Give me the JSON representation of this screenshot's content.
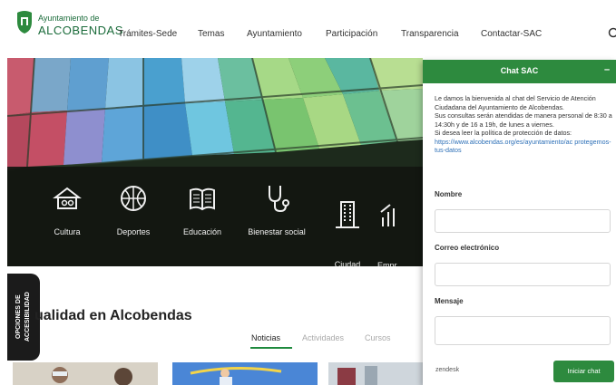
{
  "header": {
    "logo": {
      "line1": "Ayuntamiento de",
      "line2": "ALCOBENDAS"
    },
    "nav": [
      {
        "label": "Trámites-Sede"
      },
      {
        "label": "Temas"
      },
      {
        "label": "Ayuntamiento"
      },
      {
        "label": "Participación"
      },
      {
        "label": "Transparencia"
      },
      {
        "label": "Contactar-SAC"
      }
    ],
    "search_icon": "search-icon"
  },
  "hero": {
    "categories": [
      {
        "label": "Cultura",
        "icon": "culture-icon"
      },
      {
        "label": "Deportes",
        "icon": "basketball-icon"
      },
      {
        "label": "Educación",
        "icon": "book-icon"
      },
      {
        "label": "Bienestar social",
        "icon": "stethoscope-icon"
      },
      {
        "label": "Ciudad\nSostenible",
        "icon": "building-icon"
      },
      {
        "label": "Empr\nCome\nEmpl",
        "icon": "chart-icon"
      }
    ]
  },
  "accessibility": {
    "label": "OPCIONES DE ACCESIBILIDAD"
  },
  "news": {
    "title": "ualidad en Alcobendas",
    "tabs": [
      {
        "label": "Noticias",
        "active": true
      },
      {
        "label": "Actividades",
        "active": false
      },
      {
        "label": "Cursos",
        "active": false
      }
    ]
  },
  "chat": {
    "title": "Chat SAC",
    "minimize": "–",
    "intro": "Le damos la bienvenida al chat del Servicio de Atención Ciudadana del Ayuntamiento de Alcobendas.",
    "hours": "Sus consultas serán atendidas de manera personal de 8:30 a 14:30h y de 16 a 19h, de lunes a viernes.",
    "privacy": "Si desea leer la política de protección de datos:",
    "link": "https://www.alcobendas.org/es/ayuntamiento/ac protegemos-tus-datos",
    "fields": {
      "name_label": "Nombre",
      "email_label": "Correo electrónico",
      "message_label": "Mensaje"
    },
    "footer": {
      "brand": "zendesk",
      "send_label": "Iniciar chat"
    }
  },
  "colors": {
    "brand_green": "#2d8a3e",
    "link_blue": "#2c6fb7",
    "dark_band": "#12160f"
  }
}
